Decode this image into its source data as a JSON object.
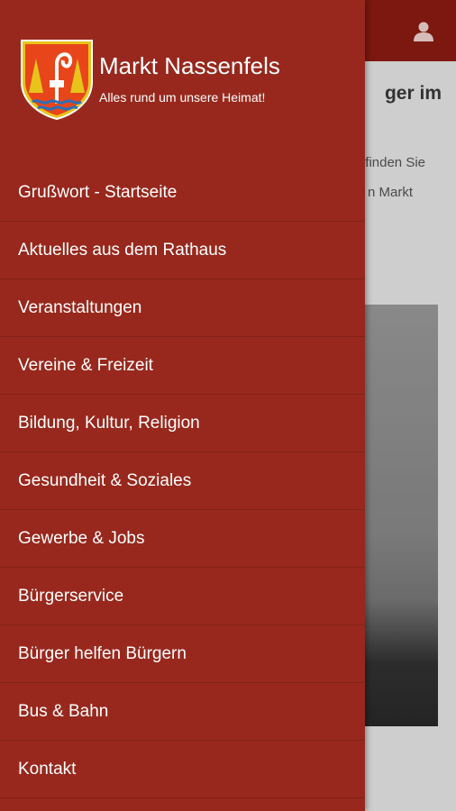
{
  "app": {
    "title": "Markt Nassenfels",
    "tagline": "Alles rund um unsere Heimat!"
  },
  "background_page": {
    "heading_fragment": "ger im",
    "text_line_1": "finden Sie",
    "text_line_2": "n Markt"
  },
  "icons": {
    "user": "user-icon",
    "crest": "coat-of-arms"
  },
  "colors": {
    "drawer": "#98281d",
    "topbar": "#8e1c12",
    "text": "#ffffff"
  },
  "menu": {
    "items": [
      {
        "label": "Grußwort - Startseite"
      },
      {
        "label": "Aktuelles aus dem Rathaus"
      },
      {
        "label": "Veranstaltungen"
      },
      {
        "label": "Vereine & Freizeit"
      },
      {
        "label": "Bildung, Kultur, Religion"
      },
      {
        "label": "Gesundheit & Soziales"
      },
      {
        "label": "Gewerbe & Jobs"
      },
      {
        "label": "Bürgerservice"
      },
      {
        "label": "Bürger helfen Bürgern"
      },
      {
        "label": "Bus & Bahn"
      },
      {
        "label": "Kontakt"
      }
    ]
  }
}
